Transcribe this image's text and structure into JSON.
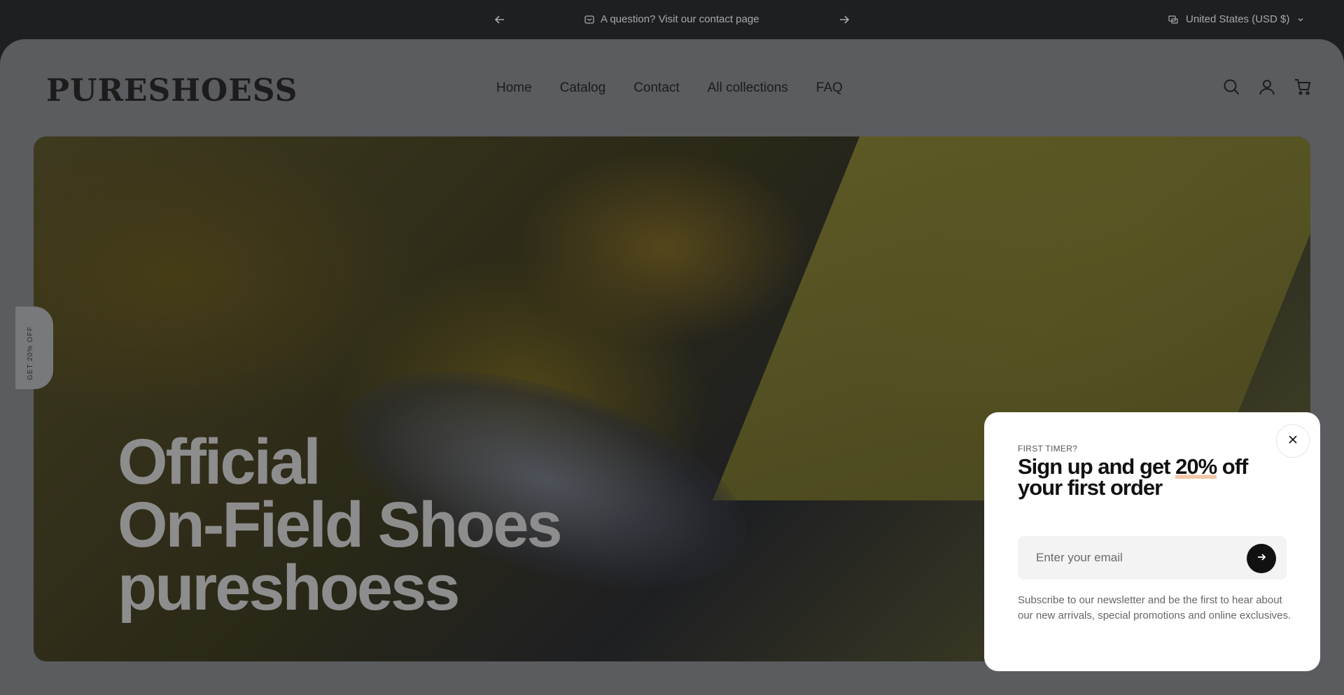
{
  "announcement": {
    "message": "A question? Visit our contact page",
    "locale": "United States (USD $)"
  },
  "header": {
    "logo": "PURESHOESS",
    "nav": [
      "Home",
      "Catalog",
      "Contact",
      "All collections",
      "FAQ"
    ]
  },
  "hero": {
    "title_lines": [
      "Official",
      "On-Field Shoes",
      "pureshoess"
    ]
  },
  "side_tab": {
    "label": "GET 20% OFF"
  },
  "popup": {
    "eyebrow": "FIRST TIMER?",
    "headline_before": "Sign up and get ",
    "headline_highlight": "20%",
    "headline_after": " off your first order",
    "email_placeholder": "Enter your email",
    "description": "Subscribe to our newsletter and be the first to hear about our new arrivals, special promotions and online exclusives."
  },
  "colors": {
    "announce_bg": "#1e1f21",
    "page_dim": "#5b5c5f",
    "popup_bg": "#ffffff",
    "highlight": "#f5c7a6"
  }
}
